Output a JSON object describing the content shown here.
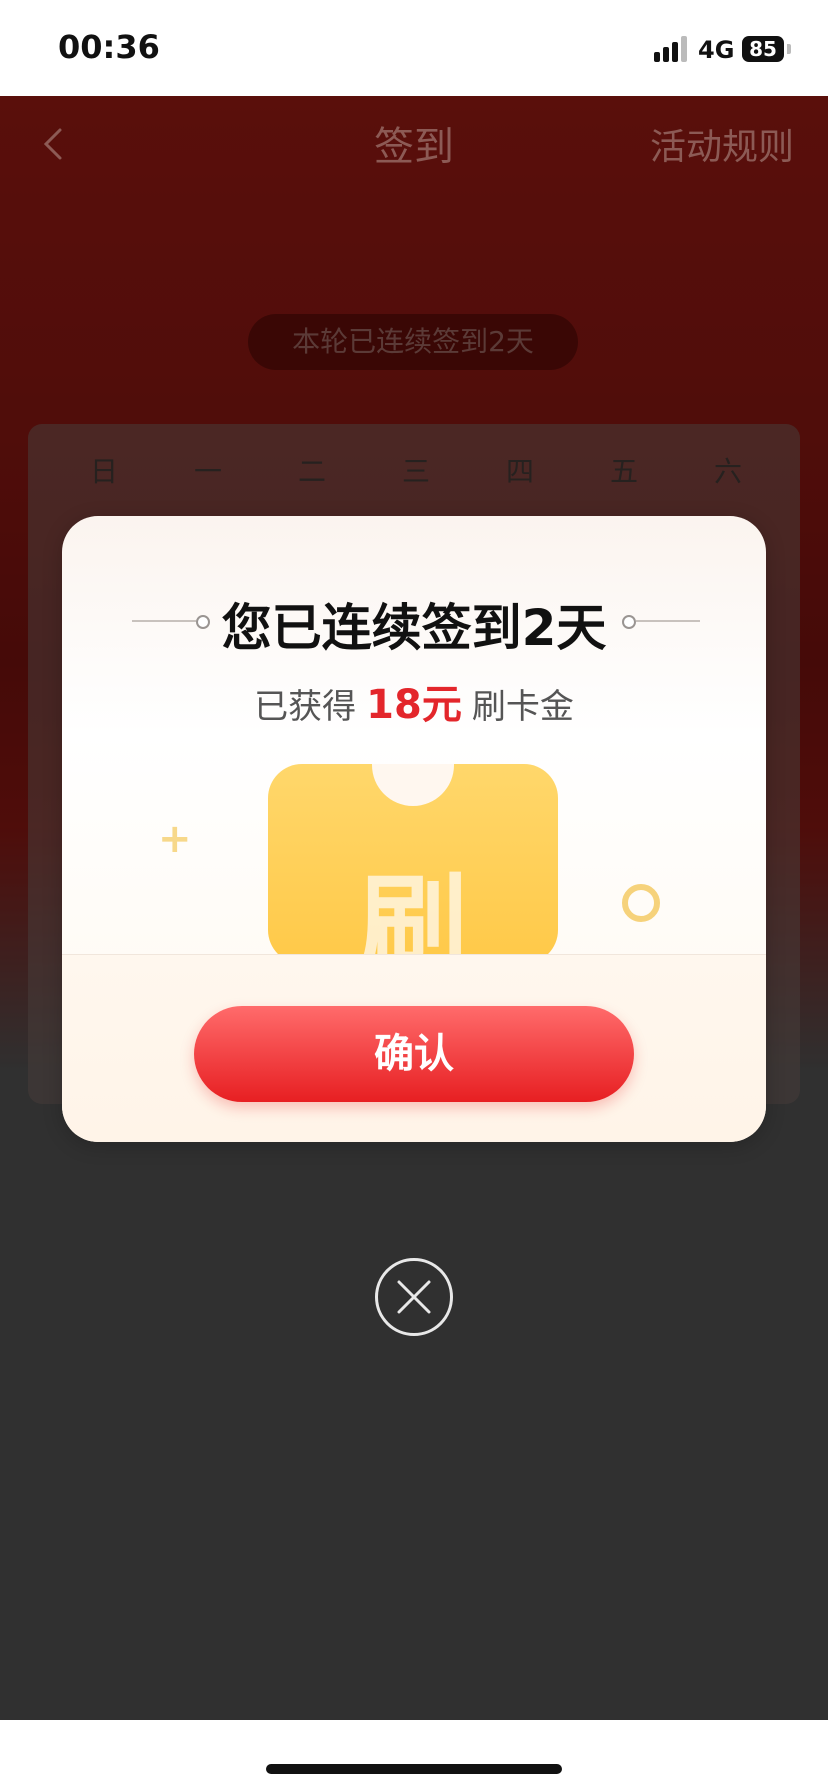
{
  "status_bar": {
    "time": "00:36",
    "network": "4G",
    "battery": "85"
  },
  "page": {
    "title": "签到",
    "rules_link": "活动规则",
    "streak_text": "本轮已连续签到2天",
    "weekdays": [
      "日",
      "一",
      "二",
      "三",
      "四",
      "五",
      "六"
    ]
  },
  "modal": {
    "title": "您已连续签到2天",
    "subtitle_prefix": "已获得",
    "amount": "18元",
    "subtitle_suffix": "刷卡金",
    "ticket_char": "刷",
    "confirm_label": "确认"
  },
  "colors": {
    "accent_red": "#e3262b",
    "header_red": "#8a1712",
    "ticket_yellow": "#ffd76b"
  },
  "icons": {
    "back": "chevron-left-icon",
    "close": "close-circle-icon",
    "signal": "cellular-signal-icon",
    "battery": "battery-icon"
  }
}
